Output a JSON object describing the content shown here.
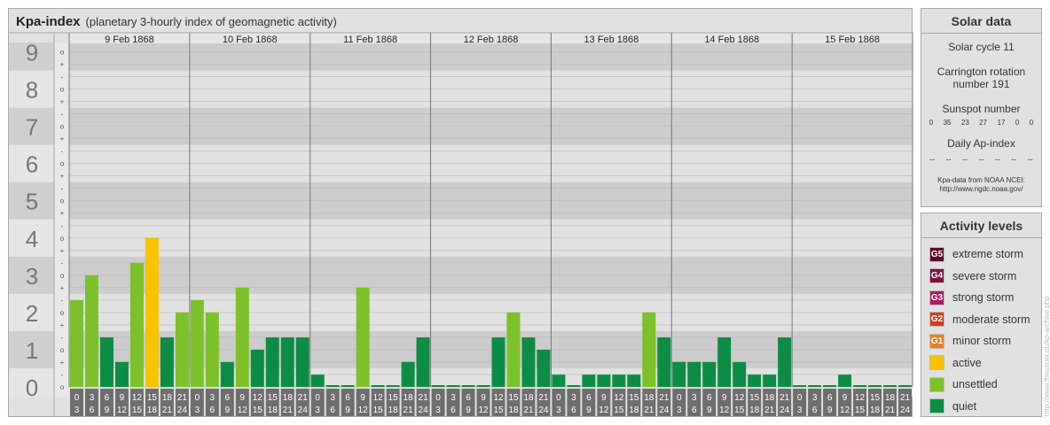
{
  "title": {
    "main": "Kpa-index",
    "subtitle": "(planetary 3-hourly index of geomagnetic activity)"
  },
  "solar": {
    "title": "Solar data",
    "cycle_label": "Solar cycle 11",
    "carrington_line1": "Carrington rotation",
    "carrington_line2": "number 191",
    "sunspot_label": "Sunspot number",
    "sunspot_values": [
      "0",
      "35",
      "23",
      "27",
      "17",
      "0",
      "0"
    ],
    "ap_label": "Daily Ap-index",
    "ap_values": [
      "--",
      "--",
      "--",
      "--",
      "--",
      "--",
      "--"
    ],
    "credit_line1": "Kpa-data from NOAA NCEI:",
    "credit_line2": "http://www.ngdc.noaa.gov/"
  },
  "activity": {
    "title": "Activity levels",
    "items": [
      {
        "code": "G5",
        "label": "extreme storm",
        "color": "#5c0a2a"
      },
      {
        "code": "G4",
        "label": "severe storm",
        "color": "#7d1343"
      },
      {
        "code": "G3",
        "label": "strong storm",
        "color": "#b01c5e"
      },
      {
        "code": "G2",
        "label": "moderate storm",
        "color": "#d63a1c"
      },
      {
        "code": "G1",
        "label": "minor storm",
        "color": "#e88020"
      },
      {
        "code": "",
        "label": "active",
        "color": "#f8c200"
      },
      {
        "code": "",
        "label": "unsettled",
        "color": "#7dc12a"
      },
      {
        "code": "",
        "label": "quiet",
        "color": "#0c8c44"
      }
    ]
  },
  "vertical_credit": "http://www.theusner.eu/kp-archive.php",
  "chart_data": {
    "type": "bar",
    "title": "Kpa-index",
    "ylim": [
      0,
      9
    ],
    "y_ticks": [
      "0",
      "1",
      "2",
      "3",
      "4",
      "5",
      "6",
      "7",
      "8",
      "9"
    ],
    "minor_marks": [
      "o",
      "+",
      "-",
      "o",
      "+",
      "-",
      "o",
      "+",
      "-",
      "o",
      "+",
      "-",
      "o",
      "+",
      "-",
      "o",
      "+",
      "-",
      "o",
      "+",
      "-",
      "o",
      "+",
      "-",
      "o",
      "+",
      "-",
      "o"
    ],
    "days": [
      "9 Feb 1868",
      "10 Feb 1868",
      "11 Feb 1868",
      "12 Feb 1868",
      "13 Feb 1868",
      "14 Feb 1868",
      "15 Feb 1868"
    ],
    "hour_start": [
      "0",
      "3",
      "6",
      "9",
      "12",
      "15",
      "18",
      "21"
    ],
    "hour_end": [
      "3",
      "6",
      "9",
      "12",
      "15",
      "18",
      "21",
      "24"
    ],
    "level_colors": {
      "quiet": "#0c8c44",
      "unsettled": "#7dc12a",
      "active": "#f8c200"
    },
    "values": [
      2.33,
      3.0,
      1.33,
      0.67,
      3.33,
      4.0,
      1.33,
      2.0,
      2.33,
      2.0,
      0.67,
      2.67,
      1.0,
      1.33,
      1.33,
      1.33,
      0.33,
      0,
      0,
      2.67,
      0,
      0,
      0.67,
      1.33,
      0,
      0,
      0,
      0,
      1.33,
      2.0,
      1.33,
      1.0,
      0.33,
      0,
      0.33,
      0.33,
      0.33,
      0.33,
      2.0,
      1.33,
      0.67,
      0.67,
      0.67,
      1.33,
      0.67,
      0.33,
      0.33,
      1.33,
      0,
      0,
      0,
      0.33,
      0,
      0,
      0,
      0
    ]
  }
}
